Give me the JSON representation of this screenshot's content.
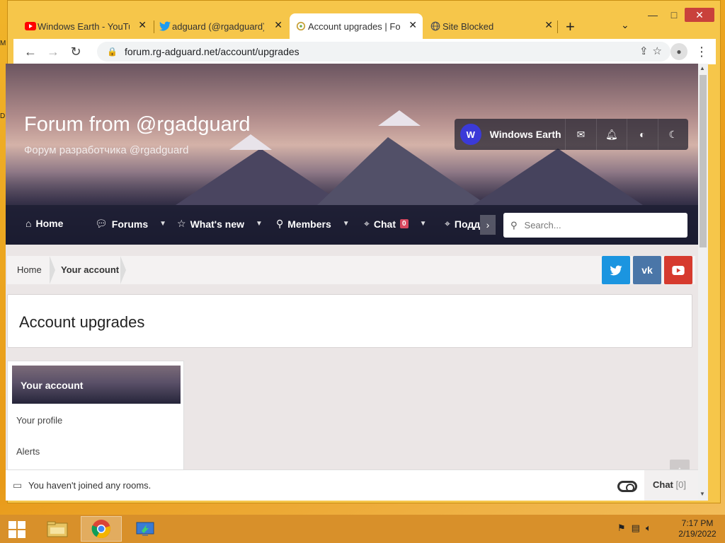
{
  "desktop": {
    "edge_letter": "M",
    "edge_letter2": "D"
  },
  "browser": {
    "tabs": [
      {
        "label": "Windows Earth - YouTub",
        "icon": "youtube-icon",
        "active": false
      },
      {
        "label": "adguard (@rgadguard)",
        "icon": "twitter-icon",
        "active": false
      },
      {
        "label": "Account upgrades | For",
        "icon": "adguard-icon",
        "active": true
      },
      {
        "label": "Site Blocked",
        "icon": "globe-icon",
        "active": false
      }
    ],
    "new_tab": "+",
    "url": "forum.rg-adguard.net/account/upgrades",
    "win_minimize": "—",
    "win_maximize": "□",
    "win_close": "✕"
  },
  "site": {
    "title": "Forum from @rgadguard",
    "subtitle": "Форум разработчика @rgadguard",
    "user": {
      "initial": "W",
      "name": "Windows Earth"
    },
    "nav": [
      {
        "label": "Home",
        "icon": "home-icon",
        "has_dropdown": false
      },
      {
        "label": "Forums",
        "icon": "chat-bubbles-icon",
        "has_dropdown": true
      },
      {
        "label": "What's new",
        "icon": "star-icon",
        "has_dropdown": true
      },
      {
        "label": "Members",
        "icon": "person-icon",
        "has_dropdown": true
      },
      {
        "label": "Chat",
        "icon": "tag-icon",
        "has_dropdown": true,
        "badge": "0"
      },
      {
        "label": "Подд",
        "icon": "tag-icon",
        "has_dropdown": false
      }
    ],
    "search_placeholder": "Search...",
    "breadcrumb": [
      "Home",
      "Your account"
    ],
    "social": [
      {
        "name": "twitter",
        "color": "#1b95e0"
      },
      {
        "name": "vk",
        "color": "#4a76a8"
      },
      {
        "name": "youtube",
        "color": "#d63a2e"
      }
    ],
    "page_title": "Account upgrades",
    "sidebar": {
      "heading": "Your account",
      "links": [
        "Your profile",
        "Alerts"
      ]
    },
    "chat": {
      "status": "You haven't joined any rooms.",
      "label": "Chat",
      "count": "[0]"
    }
  },
  "taskbar": {
    "time": "7:17 PM",
    "date": "2/19/2022"
  },
  "colors": {
    "accent_avatar": "#3b3ad8",
    "badge": "#d9485f",
    "taskbar": "#d8902a"
  }
}
